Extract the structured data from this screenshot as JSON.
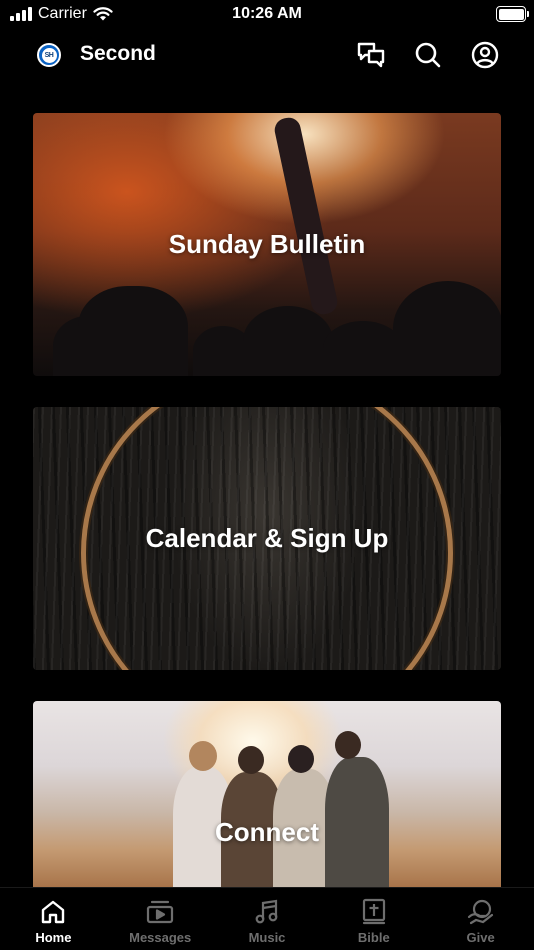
{
  "status_bar": {
    "carrier": "Carrier",
    "time": "10:26 AM"
  },
  "header": {
    "logo_text": "SH",
    "title": "Second",
    "icons": [
      "chat-icon",
      "search-icon",
      "profile-icon"
    ]
  },
  "cards": [
    {
      "label": "Sunday Bulletin"
    },
    {
      "label": "Calendar & Sign Up"
    },
    {
      "label": "Connect"
    }
  ],
  "tabs": [
    {
      "label": "Home",
      "icon": "home-icon",
      "active": true
    },
    {
      "label": "Messages",
      "icon": "video-icon",
      "active": false
    },
    {
      "label": "Music",
      "icon": "music-note-icon",
      "active": false
    },
    {
      "label": "Bible",
      "icon": "bible-icon",
      "active": false
    },
    {
      "label": "Give",
      "icon": "give-icon",
      "active": false
    }
  ],
  "colors": {
    "background": "#000000",
    "text": "#ffffff",
    "inactive_tab": "#6e6e6e",
    "logo_blue": "#0b63c4"
  }
}
